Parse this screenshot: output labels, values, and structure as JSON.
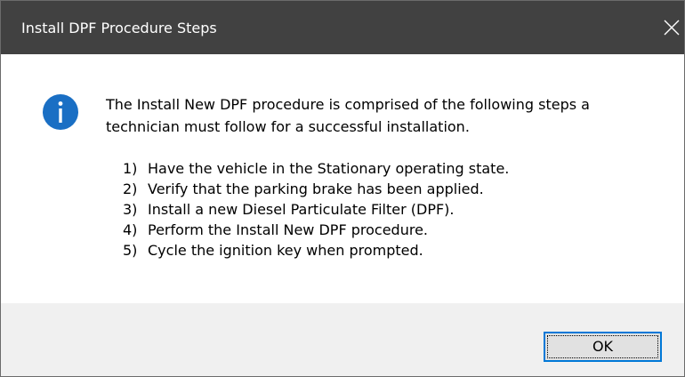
{
  "window": {
    "title": "Install DPF Procedure Steps",
    "close_icon": "close-icon",
    "accent_color": "#0078d7",
    "titlebar_color": "#414141"
  },
  "message": {
    "icon": "info-icon",
    "icon_color": "#1a6fc4",
    "intro": "The Install New DPF procedure is comprised of the following steps a technician must follow for a successful installation.",
    "steps": [
      {
        "num": "1)",
        "text": "Have the vehicle in the Stationary operating state."
      },
      {
        "num": "2)",
        "text": "Verify that the parking brake has been applied."
      },
      {
        "num": "3)",
        "text": "Install a new Diesel Particulate Filter (DPF)."
      },
      {
        "num": "4)",
        "text": "Perform the Install New DPF procedure."
      },
      {
        "num": "5)",
        "text": "Cycle the ignition key when prompted."
      }
    ]
  },
  "buttons": {
    "ok_label": "OK"
  }
}
